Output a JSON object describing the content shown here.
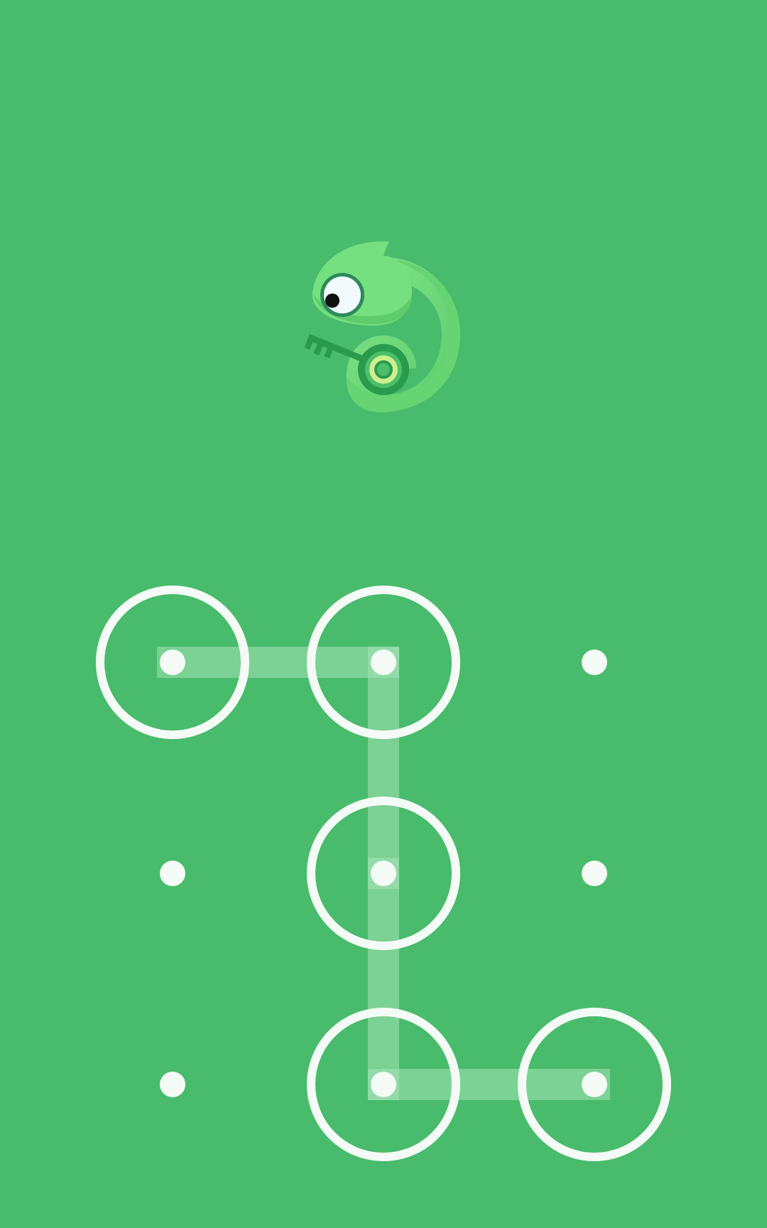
{
  "app": {
    "screen": "pattern-lock"
  },
  "colors": {
    "background": "#49bb6c",
    "ring": "#f4fbf6",
    "dot": "#f4fbf6",
    "path": "#a6e3b8",
    "mascot_body": "#6fdc7b",
    "mascot_body_dark": "#5cc96c",
    "mascot_key": "#2a9a4c"
  },
  "icons": {
    "logo": "chameleon-with-key-icon"
  },
  "pattern": {
    "rows": 3,
    "cols": 3,
    "selected": [
      0,
      1,
      4,
      7,
      8
    ],
    "path_order": [
      0,
      1,
      4,
      7,
      8
    ]
  }
}
